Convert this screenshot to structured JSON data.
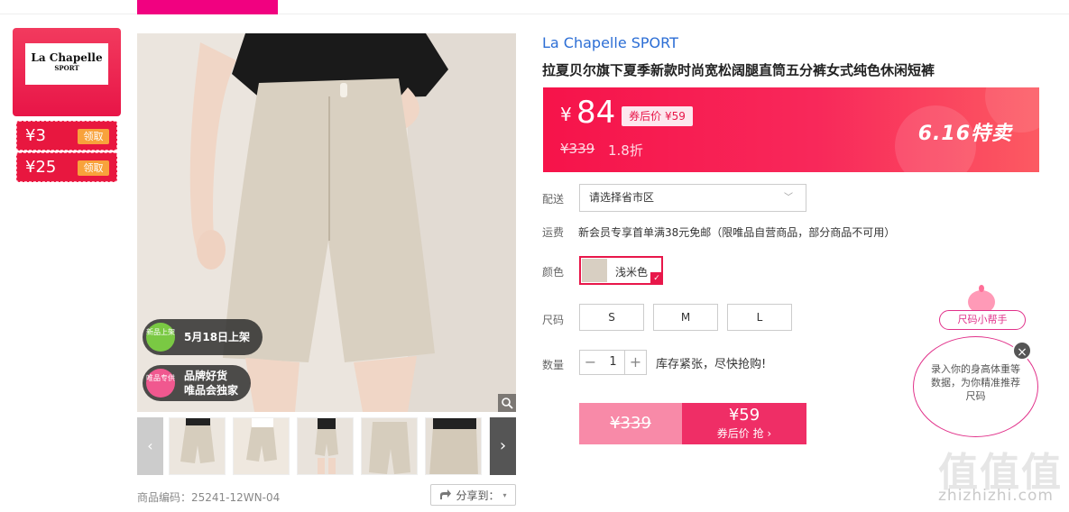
{
  "nav": {
    "active_tab": "",
    "items": []
  },
  "sidebar": {
    "brand_logo_line1": "La Chapelle",
    "brand_logo_line2": "SPORT",
    "coupons": [
      {
        "amount": "¥3",
        "claim_label": "领取"
      },
      {
        "amount": "¥25",
        "claim_label": "领取"
      }
    ]
  },
  "gallery": {
    "badges": [
      {
        "icon_text": "新品上架",
        "text": "5月18日上架",
        "color": "#7ac943"
      },
      {
        "icon_text": "唯品专供",
        "text_line1": "品牌好货",
        "text_line2": "唯品会独家",
        "color": "#f0588f"
      }
    ],
    "zoom_icon": "magnifier-icon",
    "thumb_prev": "‹",
    "thumb_next": "›"
  },
  "product": {
    "brand": "La Chapelle SPORT",
    "title": "拉夏贝尔旗下夏季新款时尚宽松阔腿直筒五分裤女式纯色休闲短裤",
    "currency": "¥",
    "price": "84",
    "coupon_price_label": "券后价 ¥59",
    "original_price": "¥339",
    "discount": "1.8折",
    "promo_tag": "6.16特卖",
    "sku_code_label": "商品编码：25241-12WN-04",
    "share_label": "分享到：",
    "accent_color": "#f6134a"
  },
  "delivery": {
    "label": "配送",
    "placeholder": "请选择省市区"
  },
  "shipping": {
    "label": "运费",
    "text": "新会员专享首单满38元免邮（限唯品自营商品，部分商品不可用）"
  },
  "color": {
    "label": "颜色",
    "selected": "浅米色"
  },
  "size": {
    "label": "尺码",
    "options": [
      "S",
      "M",
      "L"
    ]
  },
  "quantity": {
    "label": "数量",
    "value": "1",
    "minus": "−",
    "plus": "+",
    "stock_text": "库存紧张，尽快抢购!"
  },
  "buy": {
    "original": "¥339",
    "price": "¥59",
    "sub": "券后价 抢 ›"
  },
  "size_helper": {
    "title": "尺码小帮手",
    "text": "录入你的身高体重等数据，为你精准推荐尺码",
    "close": "×"
  },
  "watermark": {
    "logo": "值值值",
    "url": "zhizhizhi.com"
  }
}
